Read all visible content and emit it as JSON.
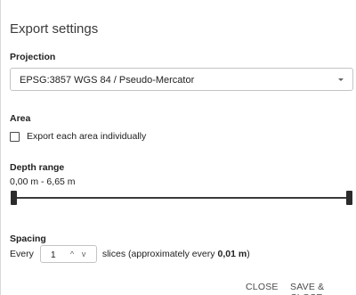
{
  "dialog": {
    "title": "Export settings"
  },
  "projection": {
    "label": "Projection",
    "value": "EPSG:3857 WGS 84 / Pseudo-Mercator",
    "icon": "chevron-down-icon"
  },
  "area": {
    "label": "Area",
    "checkbox_label": "Export each area individually",
    "checked": false
  },
  "depth": {
    "label": "Depth range",
    "range_text": "0,00 m - 6,65 m",
    "min_value": 0.0,
    "max_value": 6.65,
    "unit": "m"
  },
  "spacing": {
    "label": "Spacing",
    "prefix": "Every",
    "value": "1",
    "up_symbol": "^",
    "down_symbol": "v",
    "suffix": "slices (approximately every",
    "unit_value": "0,01 m",
    "closing": ")"
  },
  "footer": {
    "close_label": "CLOSE",
    "save_label": "SAVE & CLOSE"
  }
}
